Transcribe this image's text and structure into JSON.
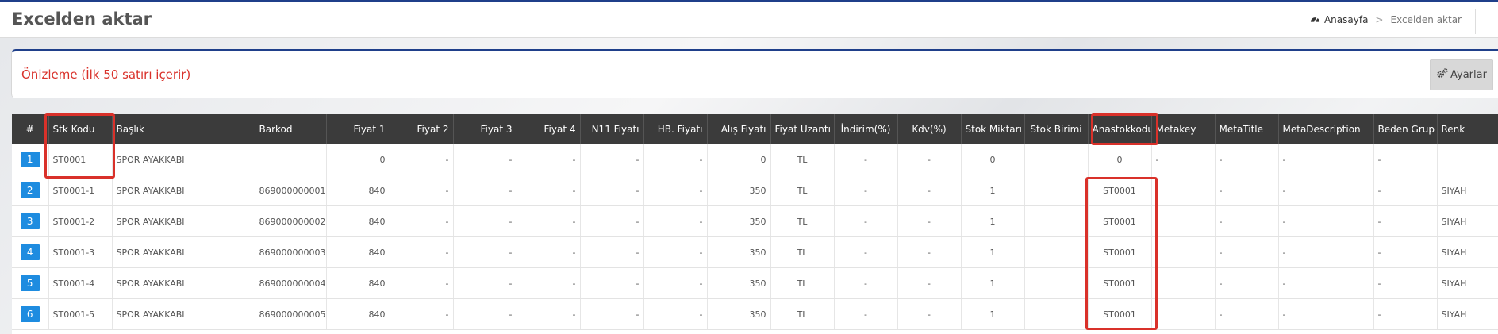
{
  "page": {
    "title": "Excelden aktar"
  },
  "breadcrumb": {
    "home_icon": "dashboard-icon",
    "home": "Anasayfa",
    "separator": ">",
    "current": "Excelden aktar"
  },
  "preview": {
    "title": "Önizleme (İlk 50 satırı içerir)",
    "settings_label": "Ayarlar",
    "settings_icon": "gears-icon"
  },
  "table": {
    "columns": [
      "#",
      "Stk Kodu",
      "Başlık",
      "Barkod",
      "Fiyat 1",
      "Fiyat 2",
      "Fiyat 3",
      "Fiyat 4",
      "N11 Fiyatı",
      "HB. Fiyatı",
      "Alış Fiyatı",
      "Fiyat Uzantı",
      "İndirim(%)",
      "Kdv(%)",
      "Stok Miktarı",
      "Stok Birimi",
      "Anastokkodu",
      "Metakey",
      "MetaTitle",
      "MetaDescription",
      "Beden Grup",
      "Renk"
    ],
    "rows": [
      [
        "1",
        "ST0001",
        "SPOR AYAKKABI",
        "",
        "0",
        "-",
        "-",
        "-",
        "-",
        "-",
        "0",
        "TL",
        "-",
        "-",
        "0",
        "",
        "0",
        "-",
        "-",
        "-",
        "-",
        ""
      ],
      [
        "2",
        "ST0001-1",
        "SPOR AYAKKABI",
        "869000000001",
        "840",
        "-",
        "-",
        "-",
        "-",
        "-",
        "350",
        "TL",
        "-",
        "-",
        "1",
        "",
        "ST0001",
        "-",
        "-",
        "-",
        "-",
        "SIYAH"
      ],
      [
        "3",
        "ST0001-2",
        "SPOR AYAKKABI",
        "869000000002",
        "840",
        "-",
        "-",
        "-",
        "-",
        "-",
        "350",
        "TL",
        "-",
        "-",
        "1",
        "",
        "ST0001",
        "-",
        "-",
        "-",
        "-",
        "SIYAH"
      ],
      [
        "4",
        "ST0001-3",
        "SPOR AYAKKABI",
        "869000000003",
        "840",
        "-",
        "-",
        "-",
        "-",
        "-",
        "350",
        "TL",
        "-",
        "-",
        "1",
        "",
        "ST0001",
        "-",
        "-",
        "-",
        "-",
        "SIYAH"
      ],
      [
        "5",
        "ST0001-4",
        "SPOR AYAKKABI",
        "869000000004",
        "840",
        "-",
        "-",
        "-",
        "-",
        "-",
        "350",
        "TL",
        "-",
        "-",
        "1",
        "",
        "ST0001",
        "-",
        "-",
        "-",
        "-",
        "SIYAH"
      ],
      [
        "6",
        "ST0001-5",
        "SPOR AYAKKABI",
        "869000000005",
        "840",
        "-",
        "-",
        "-",
        "-",
        "-",
        "350",
        "TL",
        "-",
        "-",
        "1",
        "",
        "ST0001",
        "-",
        "-",
        "-",
        "-",
        "SIYAH"
      ]
    ]
  },
  "colors": {
    "accent": "#1e8ce0",
    "highlight": "#d9312a",
    "header_bg": "#3b3b3b",
    "title_red": "#d9312a"
  }
}
